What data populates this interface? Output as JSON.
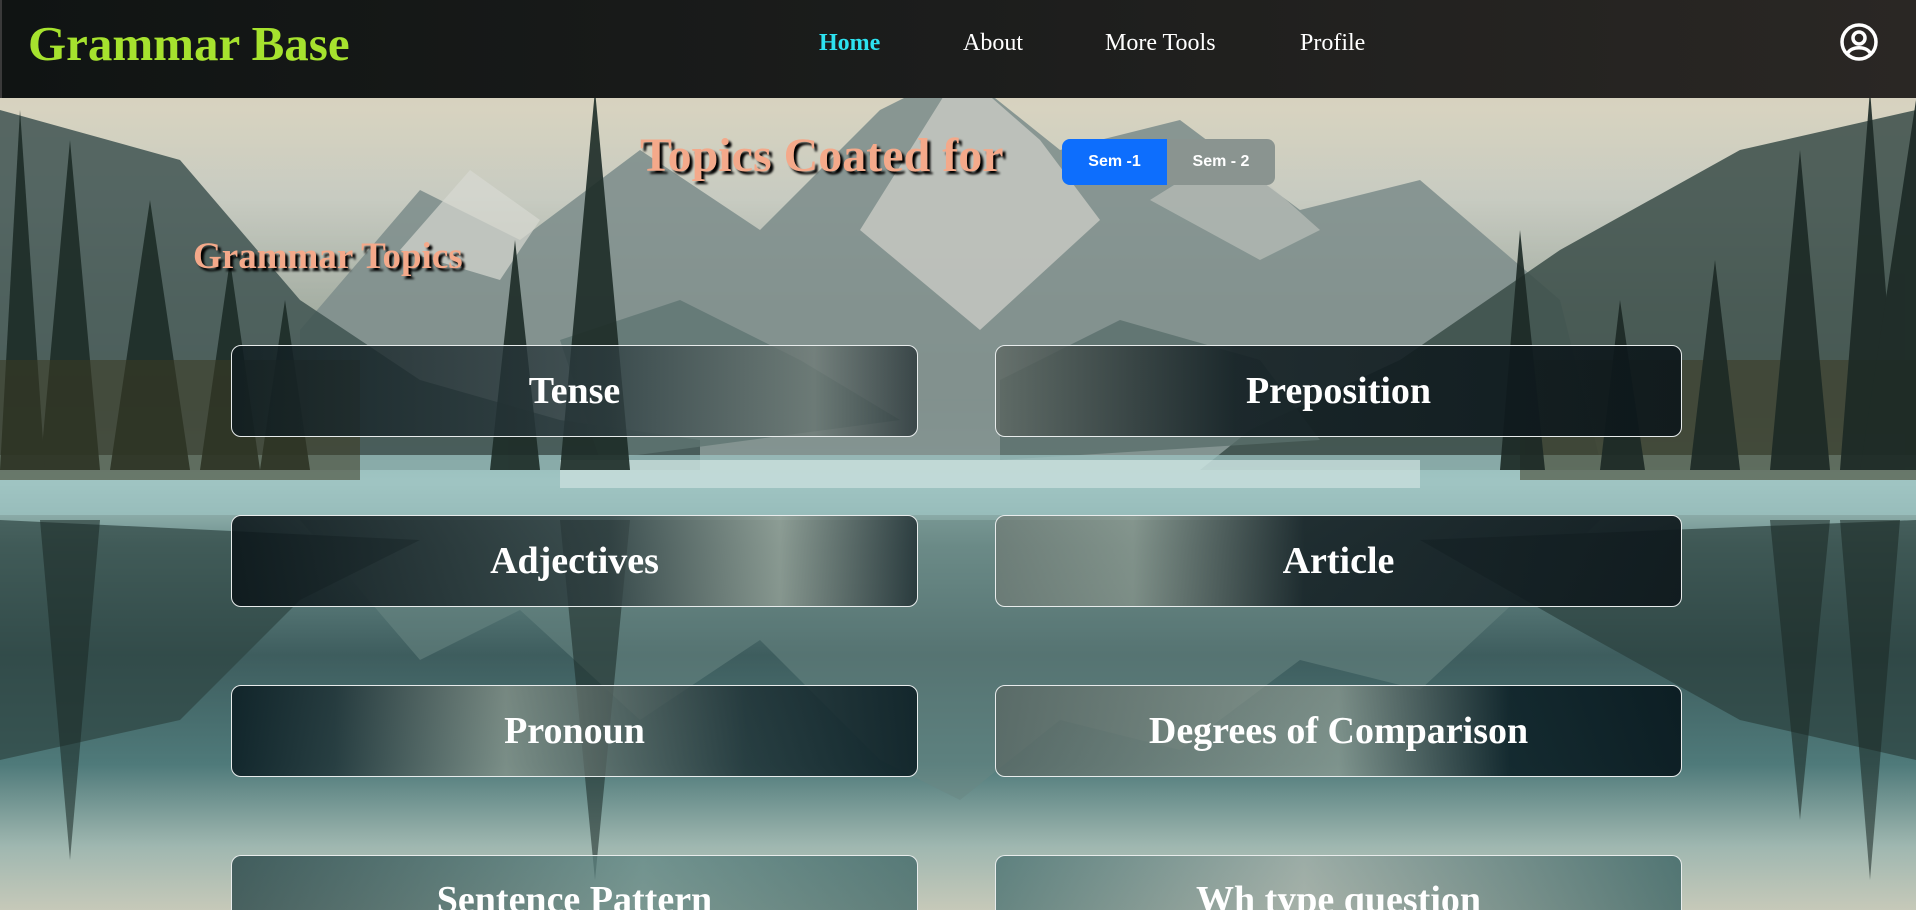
{
  "app": {
    "brand": "Grammar Base"
  },
  "nav": {
    "home": "Home",
    "about": "About",
    "more_tools": "More Tools",
    "profile": "Profile",
    "active": "Home"
  },
  "hero": {
    "heading": "Topics Coated for",
    "semester_options": [
      "Sem -1",
      "Sem - 2"
    ],
    "selected_semester": "Sem -1"
  },
  "section": {
    "heading": "Grammar Topics"
  },
  "topics": [
    "Tense",
    "Preposition",
    "Adjectives",
    "Article",
    "Pronoun",
    "Degrees of Comparison",
    "Sentence Pattern",
    "Wh type question"
  ],
  "colors": {
    "brand": "#a6e22e",
    "nav_active": "#2de2f0",
    "heading": "#f4a98a",
    "sem_selected": "#0d6efd",
    "sem_unselected": "#8a9490"
  },
  "icons": {
    "profile": "user-circle-icon"
  }
}
